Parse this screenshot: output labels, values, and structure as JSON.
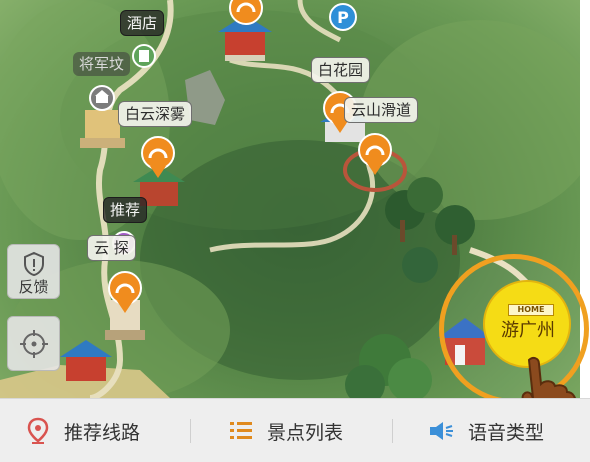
{
  "map": {
    "labels": [
      {
        "id": "hotel",
        "text": "酒店"
      },
      {
        "id": "general-tomb",
        "text": "将军坟"
      },
      {
        "id": "baiyun-mist",
        "text": "白云深雾"
      },
      {
        "id": "recommend",
        "text": "推荐"
      },
      {
        "id": "yunxi-explore",
        "text": "云  探"
      },
      {
        "id": "baihua-garden",
        "text": "白花园"
      },
      {
        "id": "mountain-slide",
        "text": "云山滑道"
      }
    ]
  },
  "side_buttons": {
    "feedback_label": "反馈",
    "locate_label": ""
  },
  "home_badge": {
    "tag": "HOME",
    "title": "游广州",
    "colors": {
      "ring": "#f0a020",
      "fill": "#f5dc15"
    }
  },
  "bottom_bar": {
    "tabs": [
      {
        "label": "推荐线路",
        "icon": "location-pin-icon",
        "color": "#d9534f"
      },
      {
        "label": "景点列表",
        "icon": "list-icon",
        "color": "#e08a1e"
      },
      {
        "label": "语音类型",
        "icon": "speaker-icon",
        "color": "#3b8fd8"
      }
    ]
  }
}
